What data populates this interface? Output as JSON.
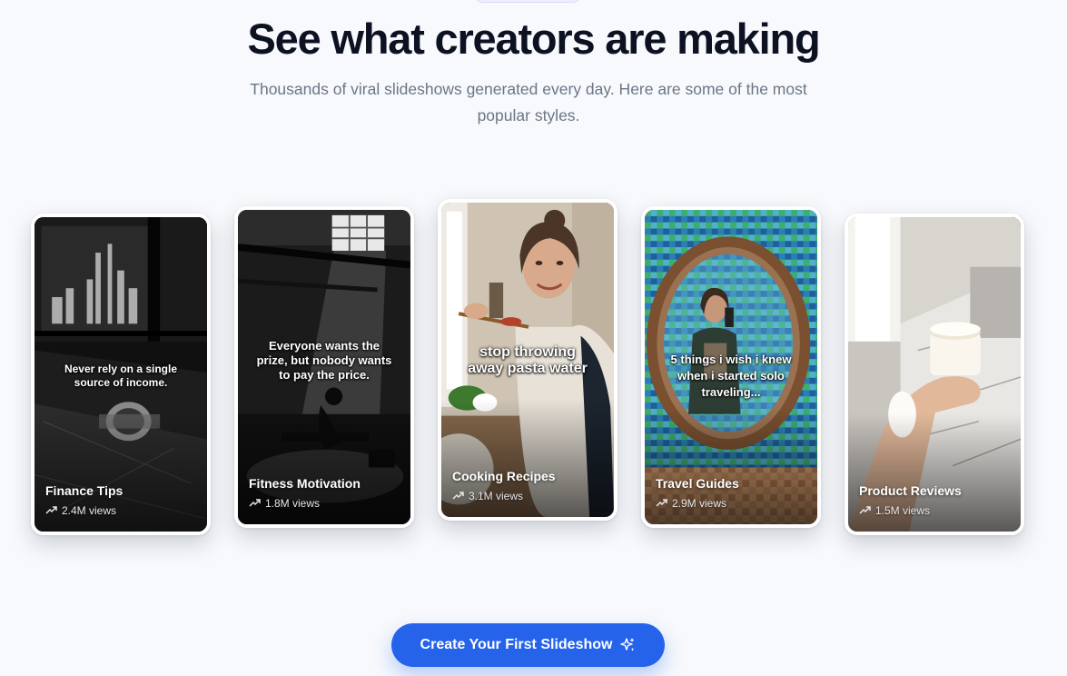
{
  "header": {
    "title": "See what creators are making",
    "subtitle": "Thousands of viral slideshows generated every day. Here are some of the most popular styles."
  },
  "cards": [
    {
      "category": "Finance Tips",
      "views": "2.4M views",
      "overlay": "Never rely on a single source of income."
    },
    {
      "category": "Fitness Motivation",
      "views": "1.8M views",
      "overlay": "Everyone wants the prize, but nobody wants to pay the price."
    },
    {
      "category": "Cooking Recipes",
      "views": "3.1M views",
      "overlay": "stop throwing away pasta water"
    },
    {
      "category": "Travel Guides",
      "views": "2.9M views",
      "overlay": "5 things i wish i knew when i started solo traveling..."
    },
    {
      "category": "Product Reviews",
      "views": "1.5M views",
      "overlay": ""
    }
  ],
  "cta": {
    "label": "Create Your First Slideshow",
    "icon": "sparkles-icon",
    "color": "#2563eb"
  }
}
